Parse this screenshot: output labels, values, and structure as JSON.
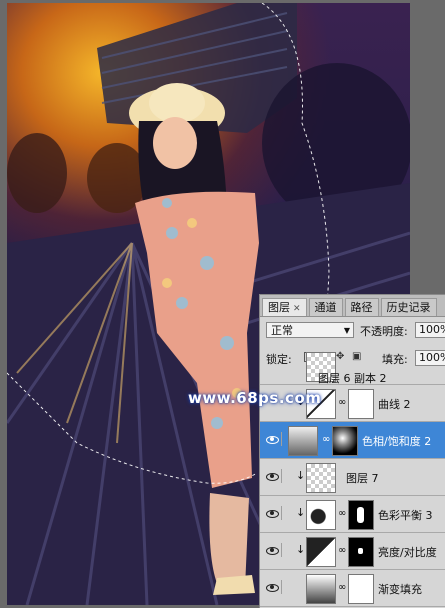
{
  "layers_panel": {
    "tabs": [
      {
        "label": "图层",
        "active": true
      },
      {
        "label": "通道",
        "active": false
      },
      {
        "label": "路径",
        "active": false
      },
      {
        "label": "历史记录",
        "active": false
      }
    ],
    "blend_mode": "正常",
    "opacity_label": "不透明度:",
    "opacity_value": "100%",
    "lock_label": "锁定:",
    "fill_label": "填充:",
    "fill_value": "100%",
    "layers": [
      {
        "name": "图层 6 副本 2"
      },
      {
        "name": "曲线 2"
      },
      {
        "name": "色相/饱和度 2",
        "selected": true
      },
      {
        "name": "图层 7"
      },
      {
        "name": "色彩平衡 3"
      },
      {
        "name": "亮度/对比度"
      },
      {
        "name": "渐变填充"
      }
    ]
  },
  "watermark": "www.68ps.com",
  "colors": {
    "selection": "#3e86d6",
    "panel_bg": "#d6d6d6",
    "glow": "#ffb020"
  }
}
